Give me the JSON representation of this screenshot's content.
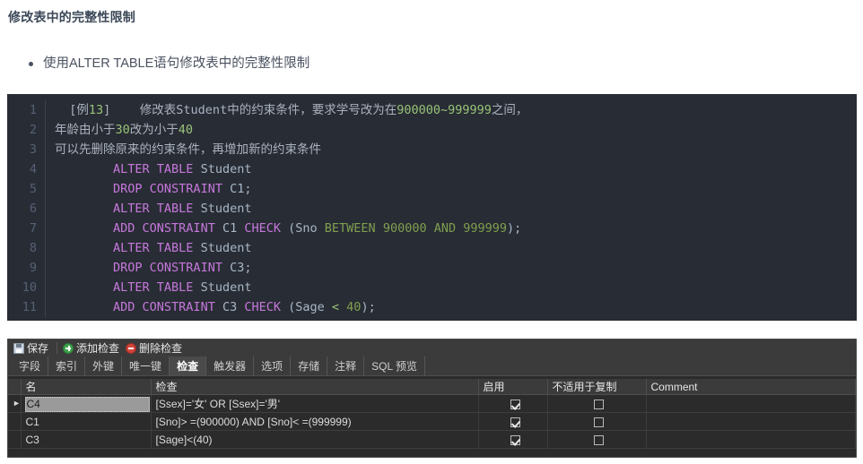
{
  "document": {
    "heading": "修改表中的完整性限制",
    "bullets": [
      "使用ALTER TABLE语句修改表中的完整性限制"
    ]
  },
  "code_block": {
    "language": "sql",
    "line_numbers": [
      "1",
      "2",
      "3",
      "4",
      "5",
      "6",
      "7",
      "8",
      "9",
      "10",
      "11"
    ],
    "lines": [
      {
        "n": "1",
        "text": "  [例13]    修改表Student中的约束条件，要求学号改为在900000~999999之间，"
      },
      {
        "n": "2",
        "text": "年龄由小于30改为小于40"
      },
      {
        "n": "3",
        "text": "可以先删除原来的约束条件，再增加新的约束条件"
      },
      {
        "n": "4",
        "text": "        ALTER TABLE Student"
      },
      {
        "n": "5",
        "text": "        DROP CONSTRAINT C1;"
      },
      {
        "n": "6",
        "text": "        ALTER TABLE Student"
      },
      {
        "n": "7",
        "text": "        ADD CONSTRAINT C1 CHECK (Sno BETWEEN 900000 AND 999999);"
      },
      {
        "n": "8",
        "text": "        ALTER TABLE Student"
      },
      {
        "n": "9",
        "text": "        DROP CONSTRAINT C3;"
      },
      {
        "n": "10",
        "text": "        ALTER TABLE Student"
      },
      {
        "n": "11",
        "text": "        ADD CONSTRAINT C3 CHECK (Sage < 40);"
      }
    ],
    "tokens": {
      "l1": [
        {
          "t": "  [例",
          "c": "plain"
        },
        {
          "t": "13",
          "c": "num"
        },
        {
          "t": "]    修改表",
          "c": "plain"
        },
        {
          "t": "Student",
          "c": "cn"
        },
        {
          "t": "中的约束条件，要求学号改为在",
          "c": "plain"
        },
        {
          "t": "900000~999999",
          "c": "num"
        },
        {
          "t": "之间，",
          "c": "plain"
        }
      ],
      "l2": [
        {
          "t": "年龄由小于",
          "c": "plain"
        },
        {
          "t": "30",
          "c": "num"
        },
        {
          "t": "改为小于",
          "c": "plain"
        },
        {
          "t": "40",
          "c": "num"
        }
      ],
      "l3": [
        {
          "t": "可以先删除原来的约束条件，再增加新的约束条件",
          "c": "plain"
        }
      ],
      "l4": [
        {
          "t": "        ",
          "c": "plain"
        },
        {
          "t": "ALTER TABLE",
          "c": "kw"
        },
        {
          "t": " Student",
          "c": "id"
        }
      ],
      "l5": [
        {
          "t": "        ",
          "c": "plain"
        },
        {
          "t": "DROP CONSTRAINT",
          "c": "kw"
        },
        {
          "t": " C1;",
          "c": "id"
        }
      ],
      "l6": [
        {
          "t": "        ",
          "c": "plain"
        },
        {
          "t": "ALTER TABLE",
          "c": "kw"
        },
        {
          "t": " Student",
          "c": "id"
        }
      ],
      "l7": [
        {
          "t": "        ",
          "c": "plain"
        },
        {
          "t": "ADD CONSTRAINT",
          "c": "kw"
        },
        {
          "t": " C1 ",
          "c": "id"
        },
        {
          "t": "CHECK",
          "c": "kw"
        },
        {
          "t": " (Sno ",
          "c": "id"
        },
        {
          "t": "BETWEEN",
          "c": "grn"
        },
        {
          "t": " ",
          "c": "id"
        },
        {
          "t": "900000",
          "c": "grn"
        },
        {
          "t": " ",
          "c": "id"
        },
        {
          "t": "AND",
          "c": "grn"
        },
        {
          "t": " ",
          "c": "id"
        },
        {
          "t": "999999",
          "c": "grn"
        },
        {
          "t": ");",
          "c": "id"
        }
      ],
      "l8": [
        {
          "t": "        ",
          "c": "plain"
        },
        {
          "t": "ALTER TABLE",
          "c": "kw"
        },
        {
          "t": " Student",
          "c": "id"
        }
      ],
      "l9": [
        {
          "t": "        ",
          "c": "plain"
        },
        {
          "t": "DROP CONSTRAINT",
          "c": "kw"
        },
        {
          "t": " C3;",
          "c": "id"
        }
      ],
      "l10": [
        {
          "t": "        ",
          "c": "plain"
        },
        {
          "t": "ALTER TABLE",
          "c": "kw"
        },
        {
          "t": " Student",
          "c": "id"
        }
      ],
      "l11": [
        {
          "t": "        ",
          "c": "plain"
        },
        {
          "t": "ADD CONSTRAINT",
          "c": "kw"
        },
        {
          "t": " C3 ",
          "c": "id"
        },
        {
          "t": "CHECK",
          "c": "kw"
        },
        {
          "t": " (Sage ",
          "c": "id"
        },
        {
          "t": "<",
          "c": "op"
        },
        {
          "t": " ",
          "c": "id"
        },
        {
          "t": "40",
          "c": "grn"
        },
        {
          "t": ");",
          "c": "id"
        }
      ]
    },
    "colors": {
      "background": "#282c34",
      "keyword": "#c678dd",
      "number": "#98c379",
      "identifier": "#a9b7c6",
      "gutter": "#566176"
    }
  },
  "panel": {
    "toolbar": {
      "save_label": "保存",
      "add_check_label": "添加检查",
      "delete_check_label": "删除检查"
    },
    "tabs": [
      {
        "label": "字段",
        "active": false
      },
      {
        "label": "索引",
        "active": false
      },
      {
        "label": "外键",
        "active": false
      },
      {
        "label": "唯一键",
        "active": false
      },
      {
        "label": "检查",
        "active": true
      },
      {
        "label": "触发器",
        "active": false
      },
      {
        "label": "选项",
        "active": false
      },
      {
        "label": "存储",
        "active": false
      },
      {
        "label": "注释",
        "active": false
      },
      {
        "label": "SQL 预览",
        "active": false
      }
    ],
    "grid": {
      "columns": [
        "名",
        "检查",
        "启用",
        "不适用于复制",
        "Comment"
      ],
      "rows": [
        {
          "selected": true,
          "name": "C4",
          "check": "[Ssex]='女' OR [Ssex]='男'",
          "enabled": true,
          "not_for_replication": false,
          "comment": ""
        },
        {
          "selected": false,
          "name": "C1",
          "check": "[Sno]> =(900000) AND [Sno]< =(999999)",
          "enabled": true,
          "not_for_replication": false,
          "comment": ""
        },
        {
          "selected": false,
          "name": "C3",
          "check": "[Sage]<(40)",
          "enabled": true,
          "not_for_replication": false,
          "comment": ""
        }
      ]
    },
    "colors": {
      "panel_background": "#3b3b3b",
      "grid_background": "#2b2b2b",
      "active_tab": "#4a4a4a",
      "selection": "#9a9a9a"
    }
  }
}
